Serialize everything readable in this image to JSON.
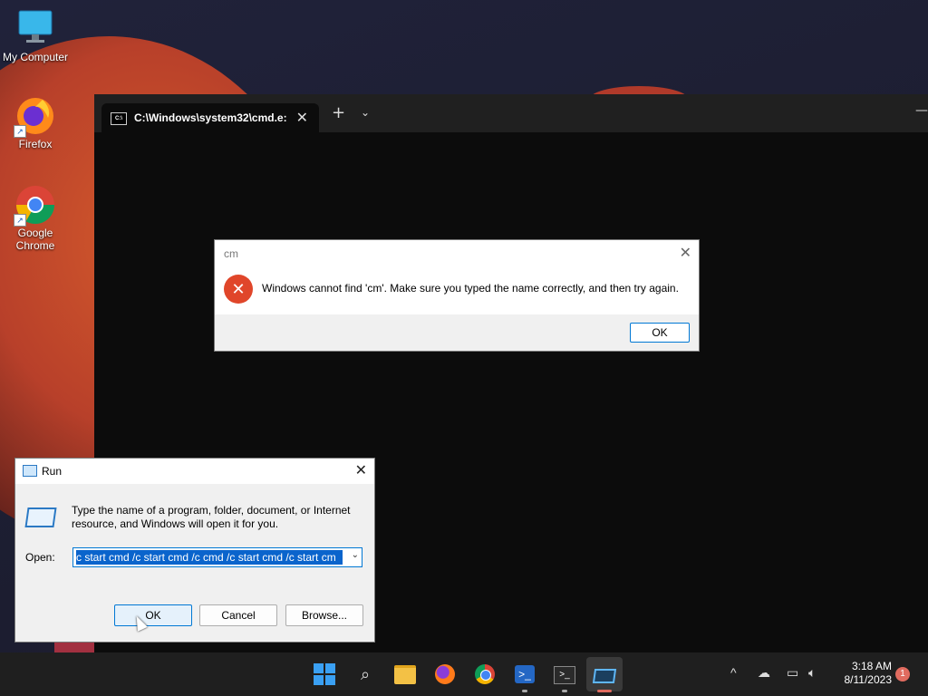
{
  "desktop": {
    "icons": [
      {
        "label": "My Computer"
      },
      {
        "label": "Firefox"
      },
      {
        "label": "Google Chrome"
      }
    ]
  },
  "terminal": {
    "tab_title": "C:\\Windows\\system32\\cmd.e:",
    "tab_icon_text": "C:\\",
    "close_glyph": "✕",
    "new_tab_glyph": "+",
    "dropdown_glyph": "⌄",
    "minimize_glyph": "—"
  },
  "error_dialog": {
    "title": "cm",
    "message": "Windows cannot find 'cm'. Make sure you typed the name correctly, and then try again.",
    "ok_label": "OK",
    "close_glyph": "✕",
    "icon": "error-x-icon"
  },
  "run_dialog": {
    "title": "Run",
    "description": "Type the name of a program, folder, document, or Internet resource, and Windows will open it for you.",
    "open_label": "Open:",
    "input_value": "c start cmd /c start cmd /c cmd /c start cmd /c start cm",
    "ok_label": "OK",
    "cancel_label": "Cancel",
    "browse_label": "Browse...",
    "close_glyph": "✕"
  },
  "taskbar": {
    "items": [
      "start",
      "search",
      "file-explorer",
      "firefox",
      "chrome",
      "powershell",
      "terminal",
      "run"
    ],
    "ps_glyph": ">_",
    "term_glyph": ">_",
    "search_glyph": "⌕",
    "tray_chevron": "^",
    "time": "3:18 AM",
    "date": "8/11/2023",
    "notification_count": "1"
  }
}
